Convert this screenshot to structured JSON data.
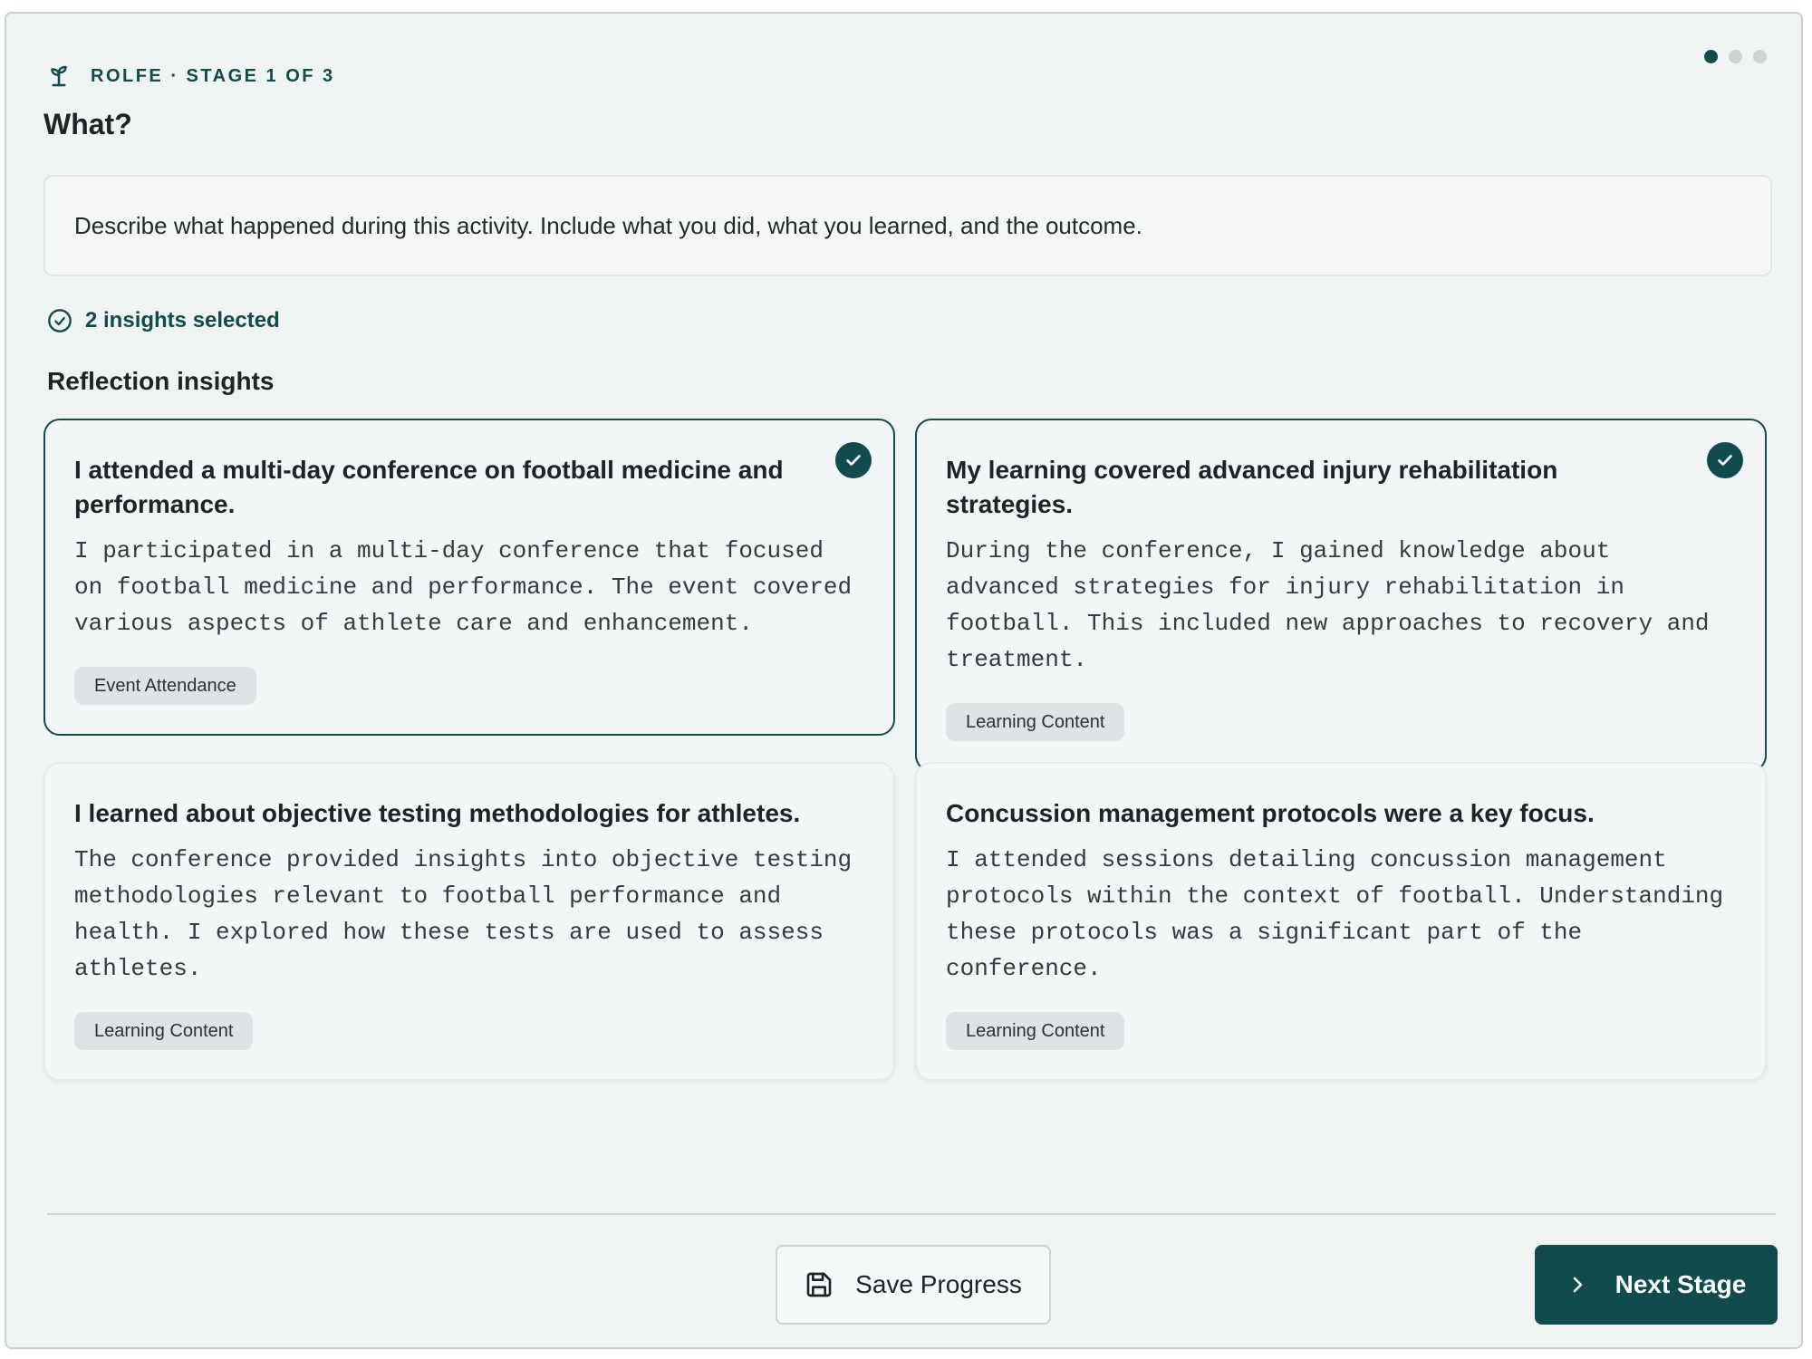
{
  "header": {
    "stage_label": "ROLFE · STAGE 1 OF 3",
    "title": "What?",
    "icon": "sprout-icon",
    "progress": {
      "total_stages": 3,
      "current_stage": 1
    }
  },
  "prompt": {
    "text": "Describe what happened during this activity. Include what you did, what you learned, and the outcome."
  },
  "selection": {
    "count_label": "2 insights selected",
    "icon": "check-circle-icon"
  },
  "insights_section": {
    "title": "Reflection insights",
    "cards": [
      {
        "title": "I attended a multi-day conference on football medicine and performance.",
        "body": "I participated in a multi-day conference that focused on football medicine and performance. The event covered various aspects of athlete care and enhancement.",
        "tag": "Event Attendance",
        "selected": true
      },
      {
        "title": "My learning covered advanced injury rehabilitation strategies.",
        "body": "During the conference, I gained knowledge about advanced strategies for injury rehabilitation in football. This included new approaches to recovery and treatment.",
        "tag": "Learning Content",
        "selected": true
      },
      {
        "title": "I learned about objective testing methodologies for athletes.",
        "body": "The conference provided insights into objective testing methodologies relevant to football performance and health. I explored how these tests are used to assess athletes.",
        "tag": "Learning Content",
        "selected": false
      },
      {
        "title": "Concussion management protocols were a key focus.",
        "body": "I attended sessions detailing concussion management protocols within the context of football. Understanding these protocols was a significant part of the conference.",
        "tag": "Learning Content",
        "selected": false
      }
    ]
  },
  "footer": {
    "save_label": "Save Progress",
    "save_icon": "floppy-disk-icon",
    "next_label": "Next Stage",
    "next_icon": "chevron-right-icon"
  },
  "colors": {
    "accent": "#114b4e",
    "background": "#eff3f2",
    "tag_background": "#dfe3e5"
  }
}
